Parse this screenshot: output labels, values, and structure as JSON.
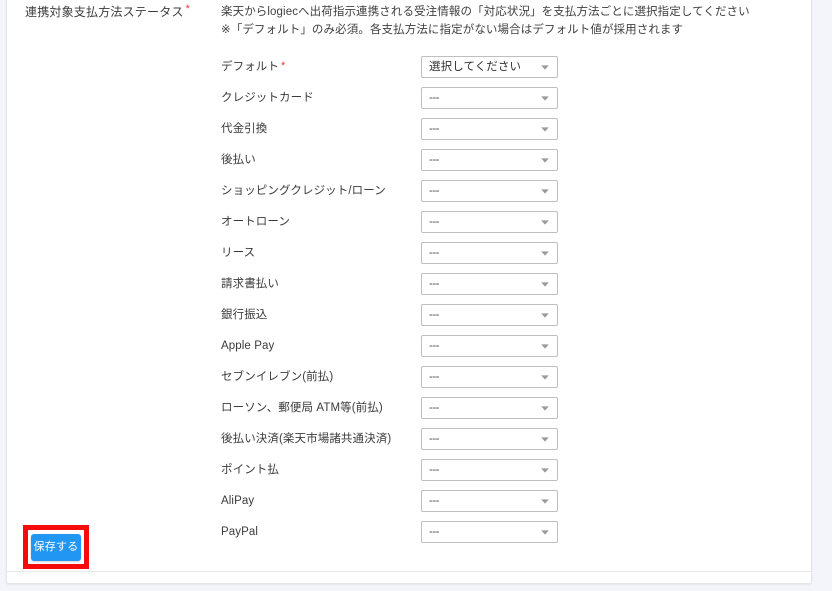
{
  "section": {
    "label": "連携対象支払方法ステータス",
    "required_marker": "*"
  },
  "helper": {
    "line1": "楽天からlogiecへ出荷指示連携される受注情報の「対応状況」を支払方法ごとに選択指定してください",
    "line2": "※「デフォルト」のみ必須。各支払方法に指定がない場合はデフォルト値が採用されます"
  },
  "select_defaults": {
    "placeholder": "選択してください",
    "empty": "---",
    "caret_icon": "chevron-down-icon"
  },
  "rows": [
    {
      "label": "デフォルト",
      "required": true,
      "required_marker": "*",
      "value": "選択してください"
    },
    {
      "label": "クレジットカード",
      "required": false,
      "required_marker": "",
      "value": "---"
    },
    {
      "label": "代金引換",
      "required": false,
      "required_marker": "",
      "value": "---"
    },
    {
      "label": "後払い",
      "required": false,
      "required_marker": "",
      "value": "---"
    },
    {
      "label": "ショッピングクレジット/ローン",
      "required": false,
      "required_marker": "",
      "value": "---"
    },
    {
      "label": "オートローン",
      "required": false,
      "required_marker": "",
      "value": "---"
    },
    {
      "label": "リース",
      "required": false,
      "required_marker": "",
      "value": "---"
    },
    {
      "label": "請求書払い",
      "required": false,
      "required_marker": "",
      "value": "---"
    },
    {
      "label": "銀行振込",
      "required": false,
      "required_marker": "",
      "value": "---"
    },
    {
      "label": "Apple Pay",
      "required": false,
      "required_marker": "",
      "value": "---"
    },
    {
      "label": "セブンイレブン(前払)",
      "required": false,
      "required_marker": "",
      "value": "---"
    },
    {
      "label": "ローソン、郵便局 ATM等(前払)",
      "required": false,
      "required_marker": "",
      "value": "---"
    },
    {
      "label": "後払い決済(楽天市場諸共通決済)",
      "required": false,
      "required_marker": "",
      "value": "---"
    },
    {
      "label": "ポイント払",
      "required": false,
      "required_marker": "",
      "value": "---"
    },
    {
      "label": "AliPay",
      "required": false,
      "required_marker": "",
      "value": "---"
    },
    {
      "label": "PayPal",
      "required": false,
      "required_marker": "",
      "value": "---"
    }
  ],
  "footer": {
    "save_label": "保存する"
  },
  "colors": {
    "accent_blue": "#2196f3",
    "highlight_red": "#f60b0b",
    "required_red": "#e53935",
    "page_background": "#f4f5fa",
    "card_background": "#ffffff",
    "border_gray": "#bfbfbf"
  }
}
